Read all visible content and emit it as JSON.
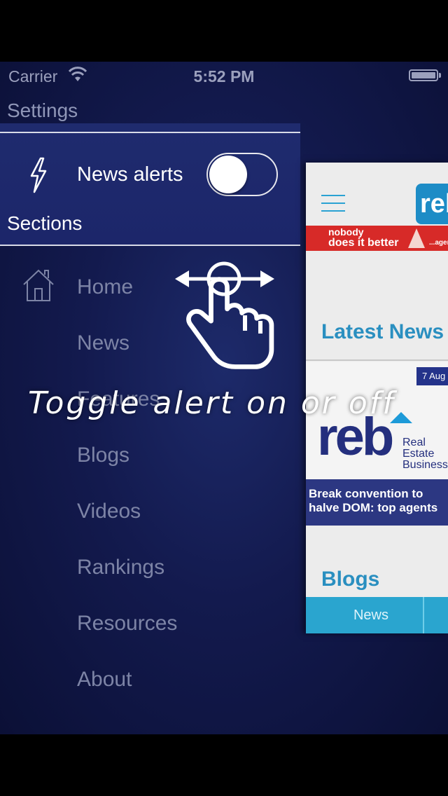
{
  "status_bar": {
    "carrier": "Carrier",
    "time": "5:52 PM",
    "battery_level": 1.0
  },
  "settings": {
    "title": "Settings",
    "news_alerts_label": "News alerts",
    "news_alerts_on": false,
    "sections_label": "Sections"
  },
  "menu": {
    "items": [
      "Home",
      "News",
      "Features",
      "Blogs",
      "Videos",
      "Rankings",
      "Resources",
      "About"
    ]
  },
  "preview": {
    "logo_text": "reb",
    "ad_line1": "nobody",
    "ad_line2": "does it better",
    "ad_tail": "...agent",
    "latest_news": "Latest News",
    "date_badge": "7 Aug",
    "card_logo": "reb",
    "card_logo_sub1": "Real",
    "card_logo_sub2": "Estate",
    "card_logo_sub3": "Business",
    "headline": "Break convention to halve DOM: top agents",
    "blogs": "Blogs",
    "tab_news": "News"
  },
  "overlay": {
    "hint": "Toggle alert on or off"
  },
  "icons": {
    "alert": "lightning-bolt-icon",
    "home": "house-icon",
    "gesture": "hand-swipe-gesture-icon",
    "menu": "hamburger-menu-icon",
    "wifi": "wifi-icon",
    "battery": "battery-icon"
  },
  "colors": {
    "panel": "#1f2b6e",
    "accent_blue": "#2a8fc0",
    "ad_red": "#d72a28"
  }
}
